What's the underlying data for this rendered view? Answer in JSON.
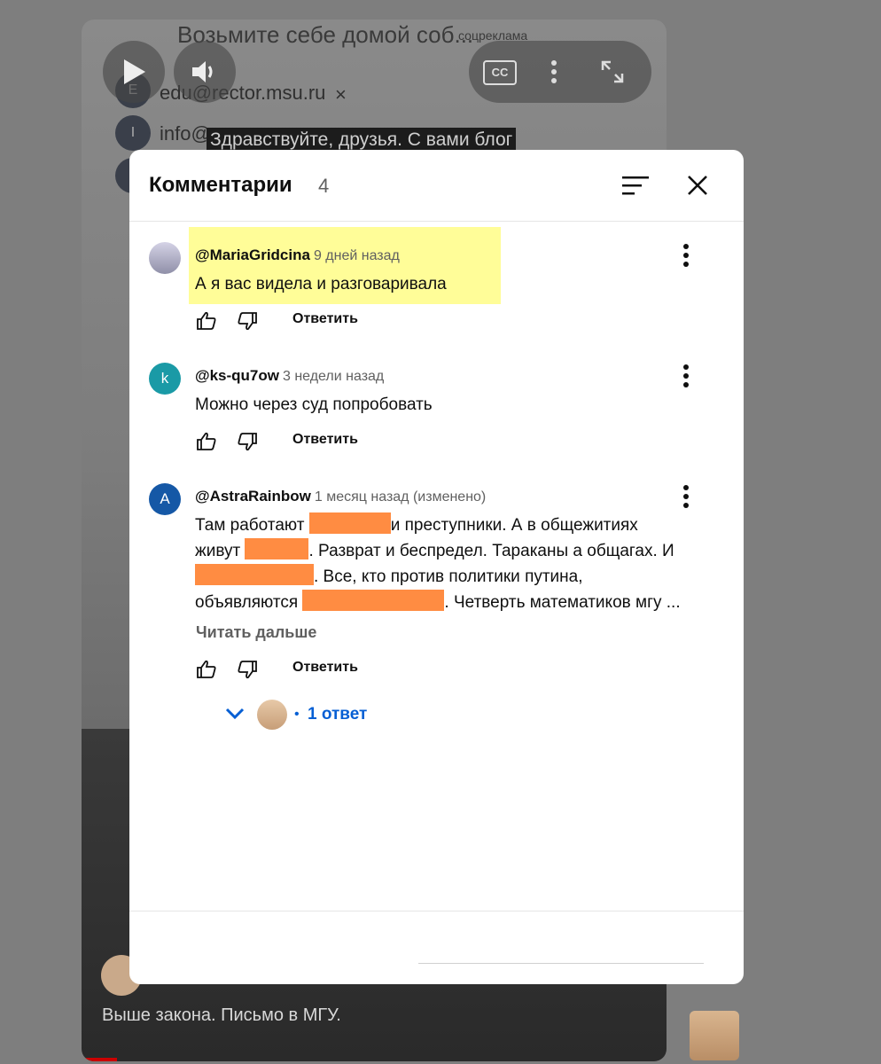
{
  "background": {
    "video_title": "Возьмите себе домой соб...",
    "video_channel": "соцреклама",
    "email_1": "edu@rector.msu.ru",
    "email_2": "info@",
    "subtitle": "Здравствуйте, друзья. С вами блог",
    "caption": "Выше закона. Письмо в МГУ.",
    "cc_label": "CC"
  },
  "panel": {
    "title": "Комментарии",
    "count": "4",
    "comments": [
      {
        "author": "@MariaGridcina",
        "time": "9 дней назад",
        "text": "А я вас видела и разговаривала",
        "reply_label": "Ответить",
        "highlight": true
      },
      {
        "author": "@ks-qu7ow",
        "time": "3 недели назад",
        "avatar_letter": "k",
        "avatar_color": "#1a9aa6",
        "text": "Можно через суд попробовать",
        "reply_label": "Ответить"
      },
      {
        "author": "@AstraRainbow",
        "time": "1 месяц назад (изменено)",
        "avatar_letter": "A",
        "avatar_color": "#1558a6",
        "text_parts": [
          "Там работают ",
          "и преступники. А в общежитиях",
          "живут ",
          ". Разврат и беспредел. Тараканы а общагах. И",
          ". Все, кто против политики путина,",
          "объявляются ",
          ". Четверть математиков мгу ..."
        ],
        "redaction_color": "#ff8c42",
        "read_more": "Читать дальше",
        "reply_label": "Ответить",
        "replies_dot": "•",
        "replies_count": "1 ответ"
      }
    ]
  }
}
